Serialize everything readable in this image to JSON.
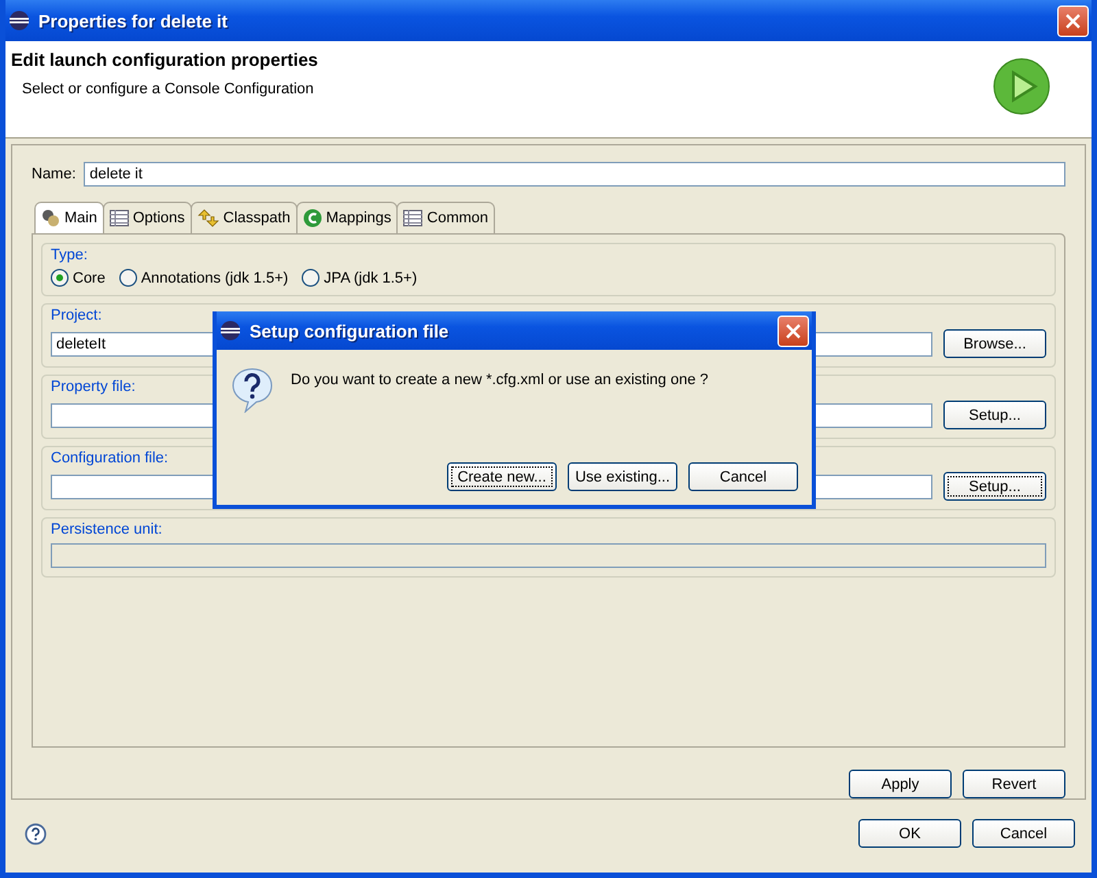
{
  "window": {
    "title": "Properties for delete it"
  },
  "header": {
    "title": "Edit launch configuration properties",
    "subtitle": "Select or configure a Console Configuration"
  },
  "name_field": {
    "label": "Name:",
    "value": "delete it"
  },
  "tabs": [
    {
      "label": "Main",
      "kind": "main",
      "selected": true
    },
    {
      "label": "Options",
      "kind": "table",
      "selected": false
    },
    {
      "label": "Classpath",
      "kind": "classpath",
      "selected": false
    },
    {
      "label": "Mappings",
      "kind": "mappings",
      "selected": false
    },
    {
      "label": "Common",
      "kind": "table",
      "selected": false
    }
  ],
  "type_group": {
    "label": "Type:",
    "options": [
      {
        "label": "Core",
        "selected": true
      },
      {
        "label": "Annotations (jdk 1.5+)",
        "selected": false
      },
      {
        "label": "JPA (jdk 1.5+)",
        "selected": false
      }
    ]
  },
  "groups": [
    {
      "label": "Project:",
      "value": "deleteIt",
      "button": "Browse...",
      "focused": false,
      "disabled": false
    },
    {
      "label": "Property file:",
      "button": "Setup...",
      "focused": false,
      "disabled": false
    },
    {
      "label": "Configuration file:",
      "button": "Setup...",
      "focused": true,
      "disabled": false
    },
    {
      "label": "Persistence unit:",
      "disabled": true
    }
  ],
  "tab_buttons": [
    "Apply",
    "Revert"
  ],
  "buttons": [
    "OK",
    "Cancel"
  ],
  "dialog": {
    "title": "Setup configuration file",
    "message": "Do you want to create a new *.cfg.xml or use an existing one ?",
    "buttons": [
      {
        "label": "Create new...",
        "focused": true
      },
      {
        "label": "Use existing...",
        "focused": false
      },
      {
        "label": "Cancel",
        "focused": false
      }
    ]
  }
}
